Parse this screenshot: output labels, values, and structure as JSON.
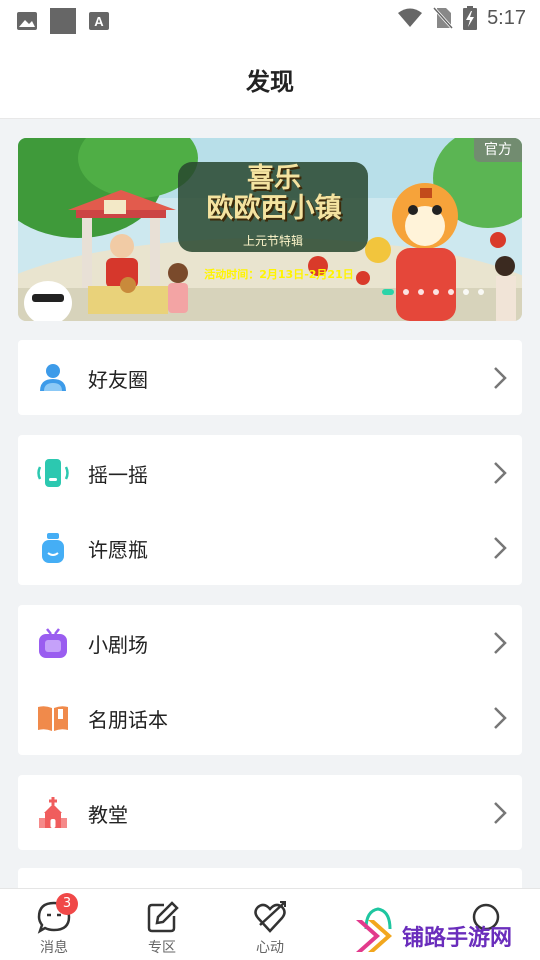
{
  "status_bar": {
    "time": "5:17",
    "icons": [
      "image-icon",
      "square-icon",
      "text-a-icon",
      "wifi-icon",
      "no-sim-icon",
      "battery-charging-icon"
    ]
  },
  "header": {
    "title": "发现"
  },
  "banner": {
    "tag": "官方",
    "title_line1": "喜乐",
    "title_line2": "欧欧西小镇",
    "subtitle": "上元节特辑",
    "date_text": "活动时间：2月13日-2月21日",
    "slide_count": 7,
    "active_slide": 1
  },
  "menu": {
    "friends": {
      "label": "好友圈",
      "icon": "friends-icon",
      "color": "#3d9be9"
    },
    "shake": {
      "label": "摇一摇",
      "icon": "shake-phone-icon",
      "color": "#2cc8b0"
    },
    "wish_bottle": {
      "label": "许愿瓶",
      "icon": "bottle-icon",
      "color": "#45aef5"
    },
    "theater": {
      "label": "小剧场",
      "icon": "tv-icon",
      "color": "#9a5df0"
    },
    "famous_story": {
      "label": "名朋话本",
      "icon": "book-icon",
      "color": "#f08a4b"
    },
    "church": {
      "label": "教堂",
      "icon": "church-icon",
      "color": "#f05d5d"
    }
  },
  "tabbar": {
    "messages": {
      "label": "消息",
      "badge": "3"
    },
    "zone": {
      "label": "专区"
    },
    "heart": {
      "label": "心动"
    }
  },
  "watermark": {
    "text": "铺路手游网"
  }
}
